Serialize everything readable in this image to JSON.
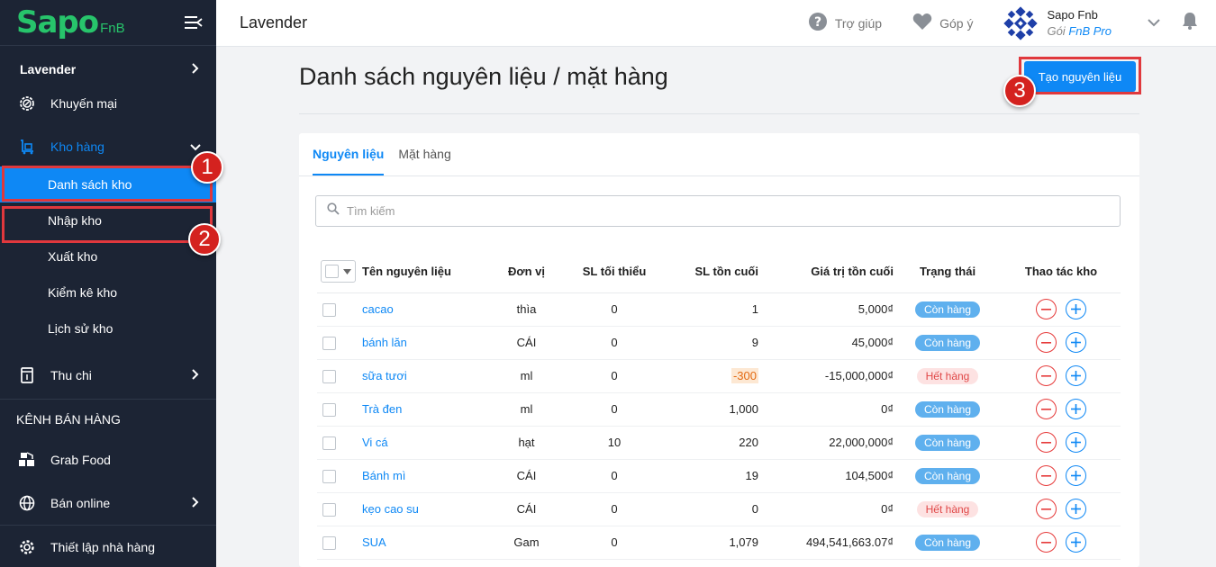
{
  "logo": {
    "main": "Sapo",
    "sub": "FnB"
  },
  "sidebar": {
    "store": "Lavender",
    "items": [
      {
        "label": "Khuyến mại",
        "icon": "percent-gear-icon"
      },
      {
        "label": "Kho hàng",
        "icon": "warehouse-icon"
      },
      {
        "label": "Thu chi",
        "icon": "cashbook-icon"
      },
      {
        "label": "Grab Food",
        "icon": "boxes-icon"
      },
      {
        "label": "Bán online",
        "icon": "globe-icon"
      },
      {
        "label": "Thiết lập nhà hàng",
        "icon": "gear-icon"
      }
    ],
    "sub_items": [
      {
        "label": "Danh sách kho"
      },
      {
        "label": "Nhập kho"
      },
      {
        "label": "Xuất kho"
      },
      {
        "label": "Kiểm kê kho"
      },
      {
        "label": "Lịch sử kho"
      }
    ],
    "channel_heading": "KÊNH BÁN HÀNG"
  },
  "header": {
    "store_name": "Lavender",
    "help": "Trợ giúp",
    "feedback": "Góp ý",
    "user_name": "Sapo Fnb",
    "plan_prefix": "Gói",
    "plan_name": "FnB Pro"
  },
  "page": {
    "title": "Danh sách nguyên liệu / mặt hàng",
    "create_button": "Tạo nguyên liệu",
    "tabs": [
      "Nguyên liệu",
      "Mặt hàng"
    ],
    "search_placeholder": "Tìm kiếm"
  },
  "table": {
    "headers": [
      "Tên nguyên liệu",
      "Đơn vị",
      "SL tối thiểu",
      "SL tồn cuối",
      "Giá trị tồn cuối",
      "Trạng thái",
      "Thao tác kho"
    ],
    "rows": [
      {
        "name": "cacao",
        "unit": "thìa",
        "min": "0",
        "stock": "1",
        "value": "5,000₫",
        "status": "Còn hàng"
      },
      {
        "name": "bánh lăn",
        "unit": "CÁI",
        "min": "0",
        "stock": "9",
        "value": "45,000₫",
        "status": "Còn hàng"
      },
      {
        "name": "sữa tươi",
        "unit": "ml",
        "min": "0",
        "stock": "-300",
        "value": "-15,000,000₫",
        "status": "Hết hàng"
      },
      {
        "name": "Trà đen",
        "unit": "ml",
        "min": "0",
        "stock": "1,000",
        "value": "0₫",
        "status": "Còn hàng"
      },
      {
        "name": "Vi cá",
        "unit": "hạt",
        "min": "10",
        "stock": "220",
        "value": "22,000,000₫",
        "status": "Còn hàng"
      },
      {
        "name": "Bánh mì",
        "unit": "CÁI",
        "min": "0",
        "stock": "19",
        "value": "104,500₫",
        "status": "Còn hàng"
      },
      {
        "name": "kẹo cao su",
        "unit": "CÁI",
        "min": "0",
        "stock": "0",
        "value": "0₫",
        "status": "Hết hàng"
      },
      {
        "name": "SUA",
        "unit": "Gam",
        "min": "0",
        "stock": "1,079",
        "value": "494,541,663.07₫",
        "status": "Còn hàng"
      }
    ]
  },
  "annotations": [
    "1",
    "2",
    "3"
  ],
  "colors": {
    "accent": "#0e88f5",
    "sidebar": "#1c2434",
    "logo": "#27c46b",
    "marker": "#d4221f"
  }
}
